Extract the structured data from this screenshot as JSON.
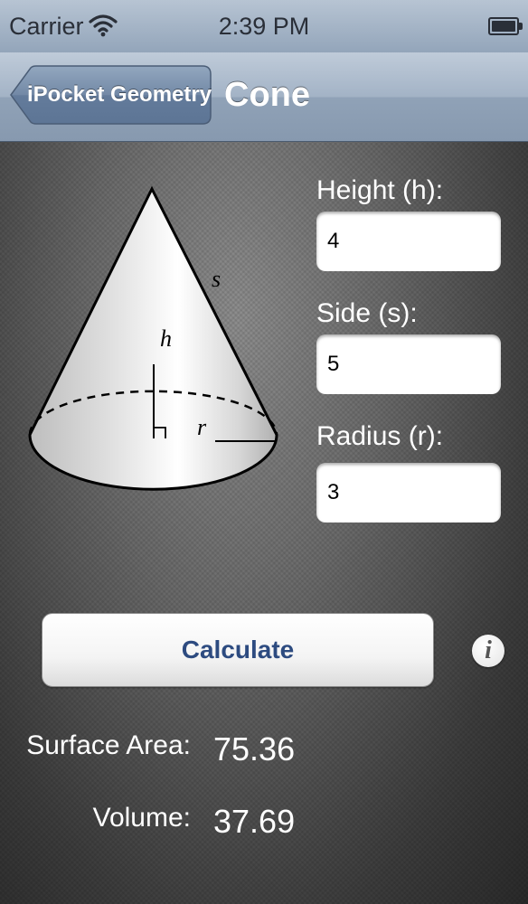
{
  "status_bar": {
    "carrier": "Carrier",
    "time": "2:39 PM",
    "icons": [
      "wifi-icon",
      "battery-icon"
    ]
  },
  "nav_bar": {
    "back_label": "iPocket Geometry",
    "title": "Cone"
  },
  "figure": {
    "labels": {
      "side": "s",
      "height": "h",
      "radius": "r"
    }
  },
  "fields": {
    "height": {
      "label": "Height (h):",
      "value": "4"
    },
    "side": {
      "label": "Side (s):",
      "value": "5"
    },
    "radius": {
      "label": "Radius (r):",
      "value": "3"
    }
  },
  "actions": {
    "calculate_label": "Calculate",
    "info_glyph": "i"
  },
  "results": {
    "surface_area": {
      "label": "Surface Area:",
      "value": "75.36"
    },
    "volume": {
      "label": "Volume:",
      "value": "37.69"
    }
  },
  "colors": {
    "nav_tint": "#9aabc0",
    "button_text": "#2d4b80"
  }
}
